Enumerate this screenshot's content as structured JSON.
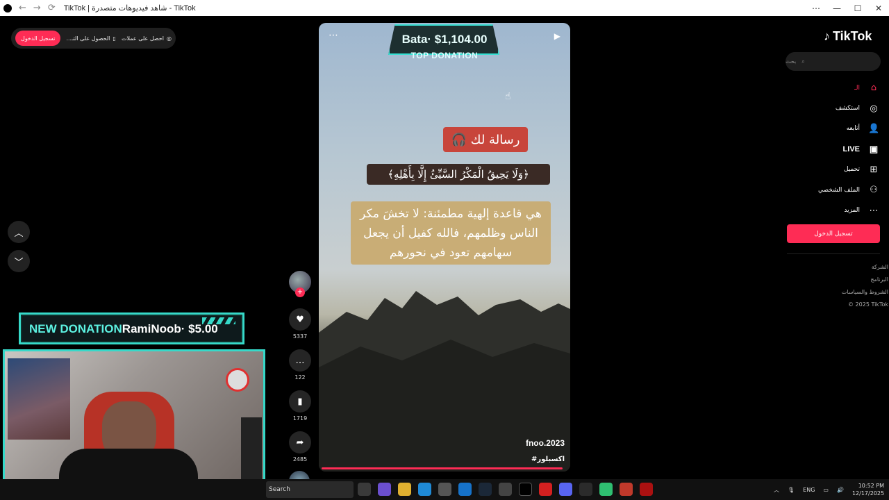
{
  "browser": {
    "title": "TikTok | شاهد فيديوهات متصدرة - TikTok",
    "min": "—",
    "max": "☐",
    "close": "✕",
    "more": "⋯"
  },
  "toppill": {
    "login": "تسجيل الدخول",
    "get_app": "الحصول على التـ...",
    "get_coins": "احصل على عملات"
  },
  "video": {
    "donation_amount": "Bata· $1,104.00",
    "donation_tag": "TOP DONATION",
    "message_chip": "رسالة لك 🎧",
    "verse": "﴿وَلَا يَحِيقُ الْمَكْرُ السَّيِّئُ إِلَّا بِأَهْلِهِ﴾",
    "quote": "هي قاعدة إلهية مطمئنة: لا تخشَ مكر الناس وظلمهم، فالله كفيل أن يجعل سهامهم تعود في نحورهم",
    "author": "fnoo.2023",
    "hashtag": "#اكسبلور",
    "progress": 0.98
  },
  "actions": {
    "likes": "5337",
    "comments": "122",
    "saves": "1719",
    "shares": "2485"
  },
  "sidebar": {
    "logo": "TikTok",
    "search_placeholder": "بحث",
    "items": [
      {
        "label": "الـ",
        "icon": "home-icon"
      },
      {
        "label": "استكشف",
        "icon": "compass-icon"
      },
      {
        "label": "أتابعه",
        "icon": "following-icon"
      },
      {
        "label": "LIVE",
        "icon": "live-icon"
      },
      {
        "label": "تحميل",
        "icon": "upload-icon"
      },
      {
        "label": "الملف الشخصي",
        "icon": "profile-icon"
      },
      {
        "label": "المزيد",
        "icon": "more-icon"
      }
    ],
    "login_button": "تسجيل الدخول",
    "footer": [
      "الشركة",
      "البرنامج",
      "الشروط والسياسات",
      "© 2025 TikTok"
    ]
  },
  "overlay": {
    "new_donation_label": "NEW DONATION",
    "new_donation_text": "RamiNoob· $5.00"
  },
  "taskbar": {
    "search": "Search",
    "lang": "ENG",
    "time": "10:52 PM",
    "date": "12/17/2025"
  },
  "colors": {
    "accent": "#fe2c55",
    "overlay_teal": "#36d9c9"
  }
}
